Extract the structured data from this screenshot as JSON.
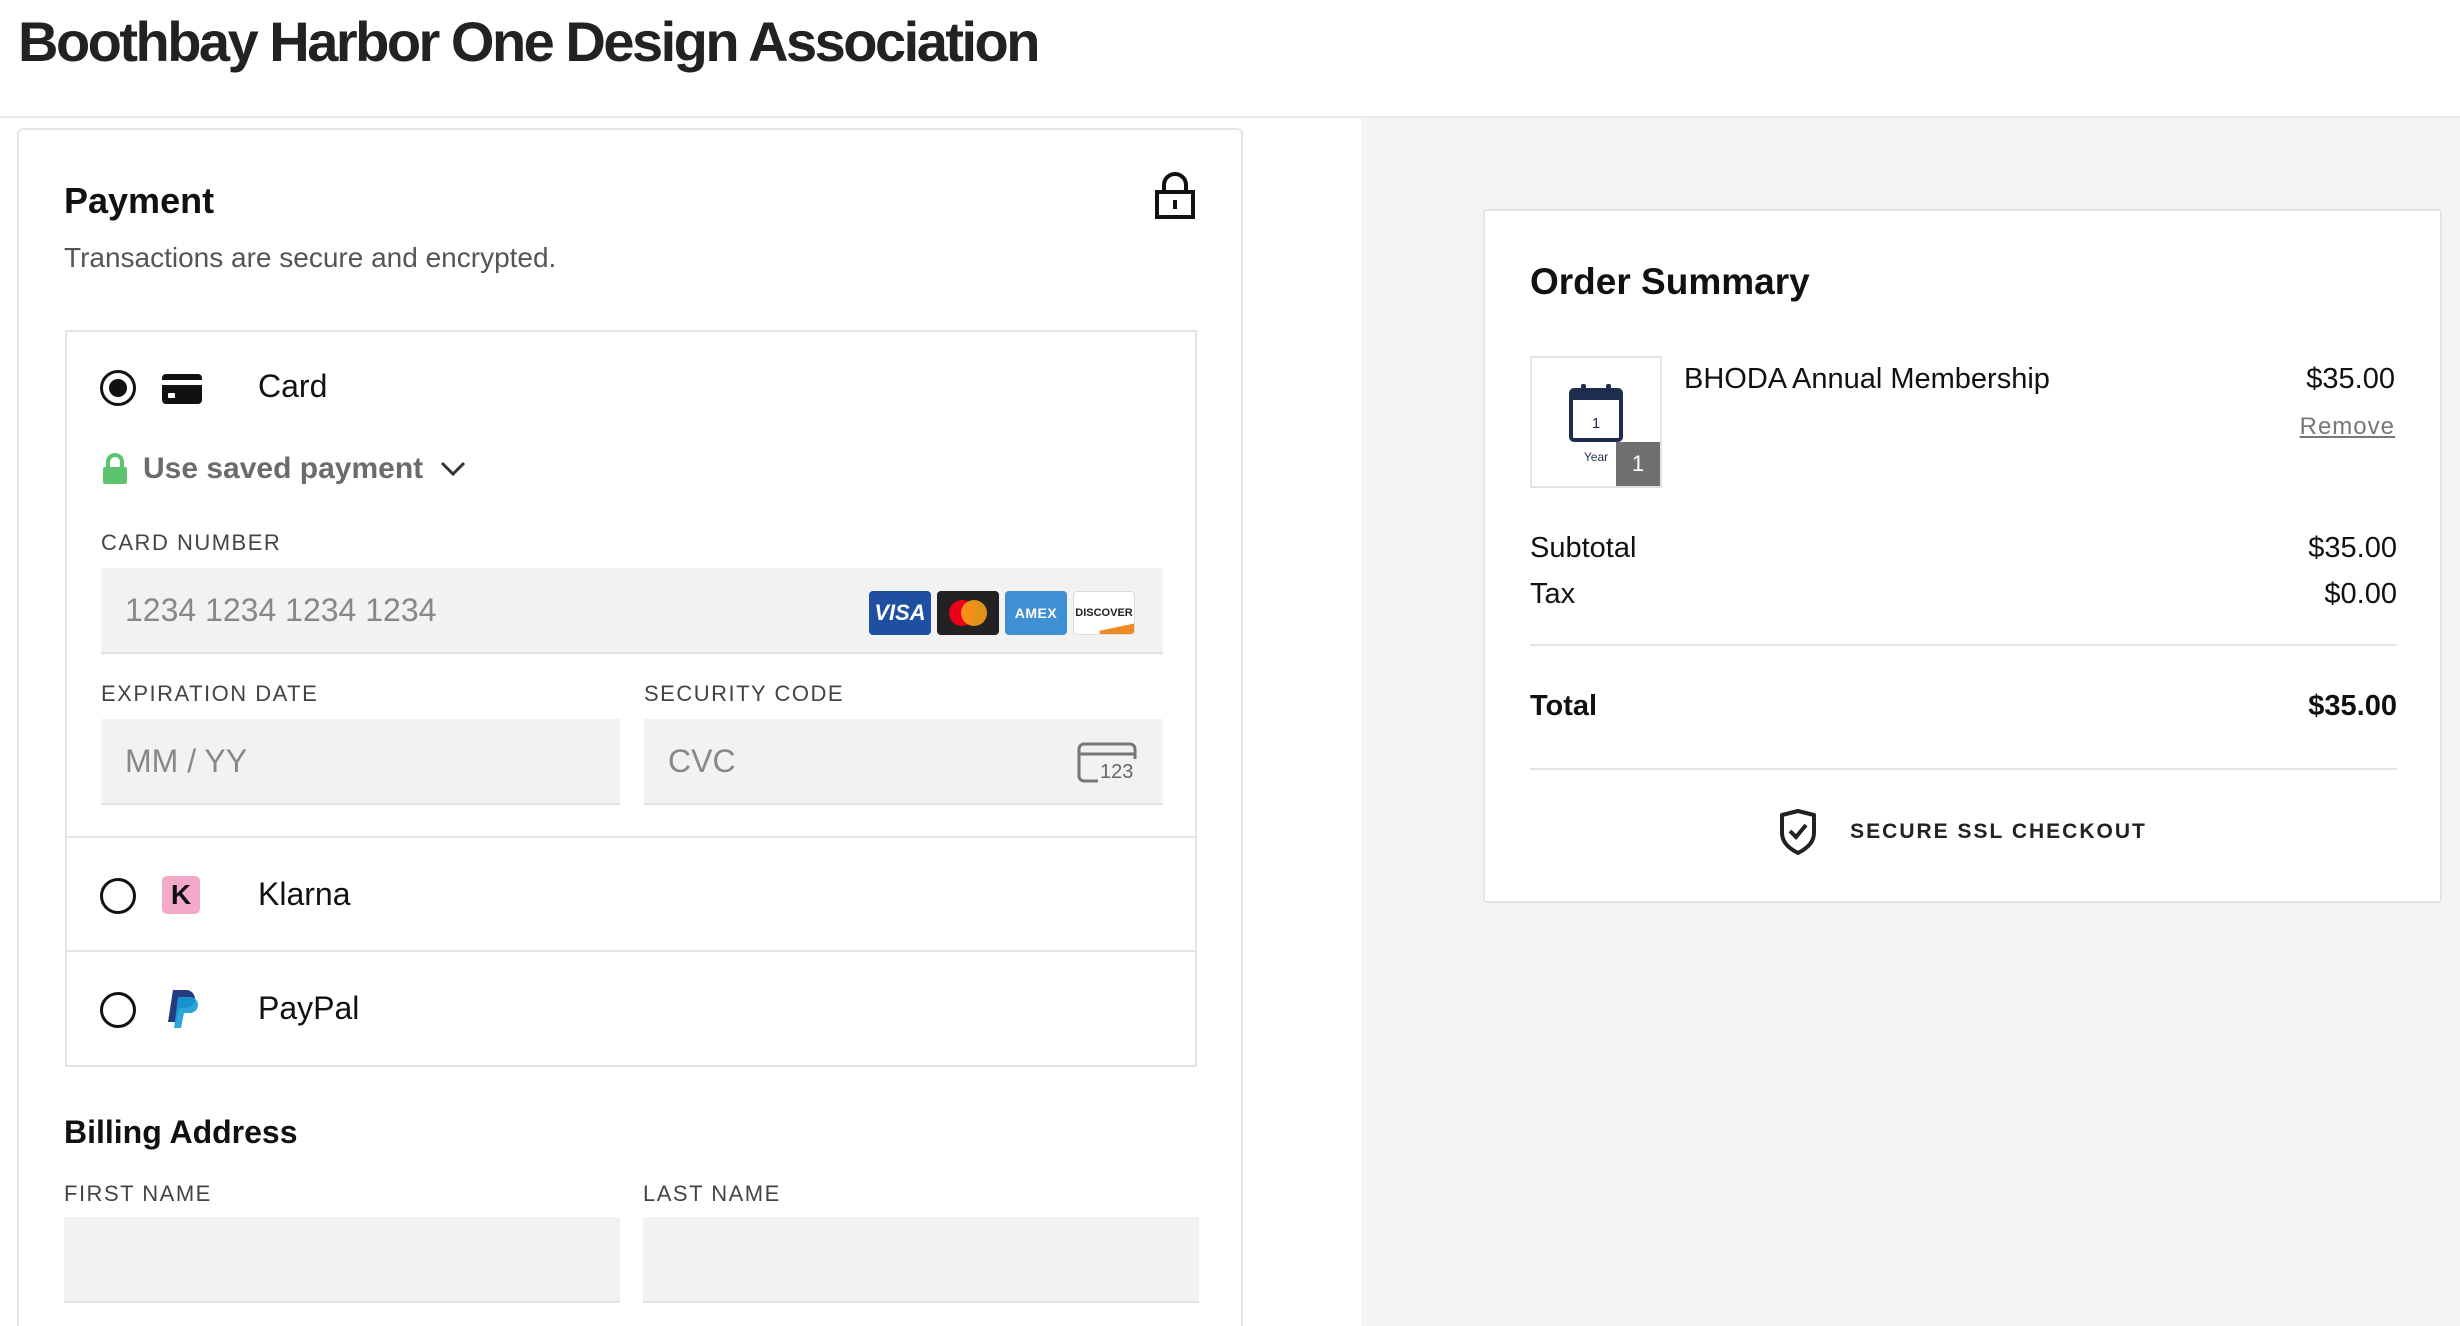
{
  "header": {
    "title": "Boothbay Harbor One Design Association"
  },
  "payment": {
    "title": "Payment",
    "subtitle": "Transactions are secure and encrypted.",
    "methods": [
      {
        "label": "Card",
        "selected": true
      },
      {
        "label": "Klarna",
        "selected": false
      },
      {
        "label": "PayPal",
        "selected": false
      }
    ],
    "saved_payment_label": "Use saved payment",
    "card_number": {
      "label": "CARD NUMBER",
      "placeholder": "1234 1234 1234 1234"
    },
    "expiration": {
      "label": "EXPIRATION DATE",
      "placeholder": "MM / YY"
    },
    "security": {
      "label": "SECURITY CODE",
      "placeholder": "CVC",
      "icon_text": "123"
    },
    "card_brands": {
      "visa": "VISA",
      "amex": "AMEX",
      "discover": "DISCOVER"
    }
  },
  "billing": {
    "title": "Billing Address",
    "first_name": {
      "label": "FIRST NAME",
      "value": ""
    },
    "last_name": {
      "label": "LAST NAME",
      "value": ""
    }
  },
  "order_summary": {
    "title": "Order Summary",
    "item": {
      "name": "BHODA Annual Membership",
      "price": "$35.00",
      "remove_label": "Remove",
      "quantity": "1",
      "thumb_day": "1",
      "thumb_caption": "Year"
    },
    "subtotal": {
      "label": "Subtotal",
      "value": "$35.00"
    },
    "tax": {
      "label": "Tax",
      "value": "$0.00"
    },
    "total": {
      "label": "Total",
      "value": "$35.00"
    },
    "secure_label": "SECURE SSL CHECKOUT"
  },
  "colors": {
    "lock_green": "#5cc36e",
    "visa_blue": "#1f4fa0",
    "amex_blue": "#3f8fd3",
    "klarna_pink": "#f5a9c9",
    "paypal_dark": "#253b80",
    "paypal_light": "#179bd7",
    "calendar_navy": "#1e2d4f"
  }
}
